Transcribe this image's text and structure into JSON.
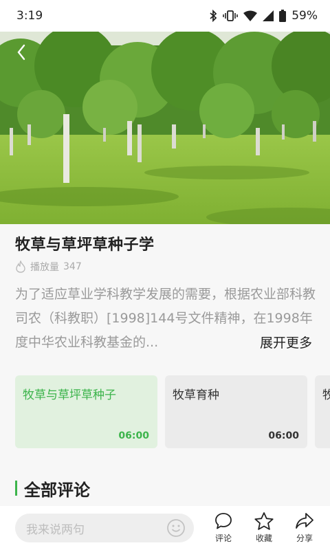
{
  "status": {
    "time": "3:19",
    "battery": "59%"
  },
  "video": {
    "title": "牧草与草坪草种子学",
    "plays_label": "播放量",
    "plays_count": "347",
    "description": "为了适应草业学科教学发展的需要，根据农业部科教司农（科教职）[1998]144号文件精神，在1998年度中华农业科教基金的...",
    "expand_label": "展开更多"
  },
  "episodes": [
    {
      "title": "牧草与草坪草种子",
      "duration": "06:00",
      "active": true
    },
    {
      "title": "牧草育种",
      "duration": "06:00",
      "active": false
    },
    {
      "title": "牧",
      "duration": "",
      "active": false
    }
  ],
  "comments_section": {
    "title": "全部评论"
  },
  "bottom_bar": {
    "input_placeholder": "我来说两句",
    "comment_label": "评论",
    "favorite_label": "收藏",
    "share_label": "分享"
  },
  "colors": {
    "accent": "#3cb44b",
    "active_card_bg": "#e1f1df"
  }
}
